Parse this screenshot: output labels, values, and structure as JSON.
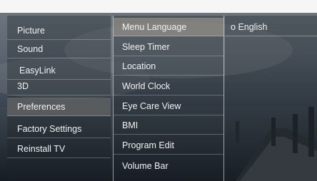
{
  "menu": {
    "level1": [
      "Picture",
      "Sound",
      "EasyLink",
      "3D",
      "Preferences",
      "Factory Settings",
      "Reinstall TV"
    ],
    "level2": [
      "Menu Language",
      "Sleep Timer",
      "Location",
      "World Clock",
      "Eye Care View",
      "BMI",
      "Program Edit",
      "Volume Bar"
    ],
    "level3": {
      "bullet": "o",
      "label": "English"
    }
  },
  "colors": {
    "active_level1": "#6e6e6e",
    "active_level2": "#aaa096"
  }
}
